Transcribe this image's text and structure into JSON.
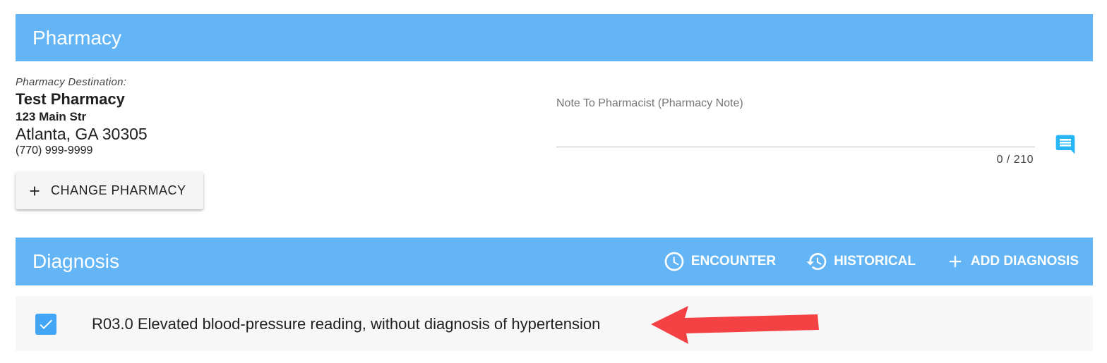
{
  "pharmacy": {
    "header_title": "Pharmacy",
    "destination_label": "Pharmacy Destination:",
    "name": "Test Pharmacy",
    "street": "123 Main Str",
    "city_state_zip": "Atlanta, GA 30305",
    "phone": "(770) 999-9999",
    "change_button_label": "CHANGE PHARMACY",
    "change_button_icon": "plus-icon",
    "note": {
      "label": "Note To Pharmacist (Pharmacy Note)",
      "value": "",
      "counter": "0 / 210",
      "icon": "comment-icon"
    }
  },
  "diagnosis": {
    "header_title": "Diagnosis",
    "actions": [
      {
        "label": "ENCOUNTER",
        "icon": "clock-icon"
      },
      {
        "label": "HISTORICAL",
        "icon": "history-icon"
      },
      {
        "label": "ADD DIAGNOSIS",
        "icon": "plus-icon"
      }
    ],
    "items": [
      {
        "checked": true,
        "text": "R03.0 Elevated blood-pressure reading, without diagnosis of hypertension"
      }
    ]
  },
  "colors": {
    "header_bg": "#64b5f6",
    "checkbox": "#42a5f5",
    "comment_icon": "#29b6f6",
    "annotation_arrow": "#f44144"
  }
}
